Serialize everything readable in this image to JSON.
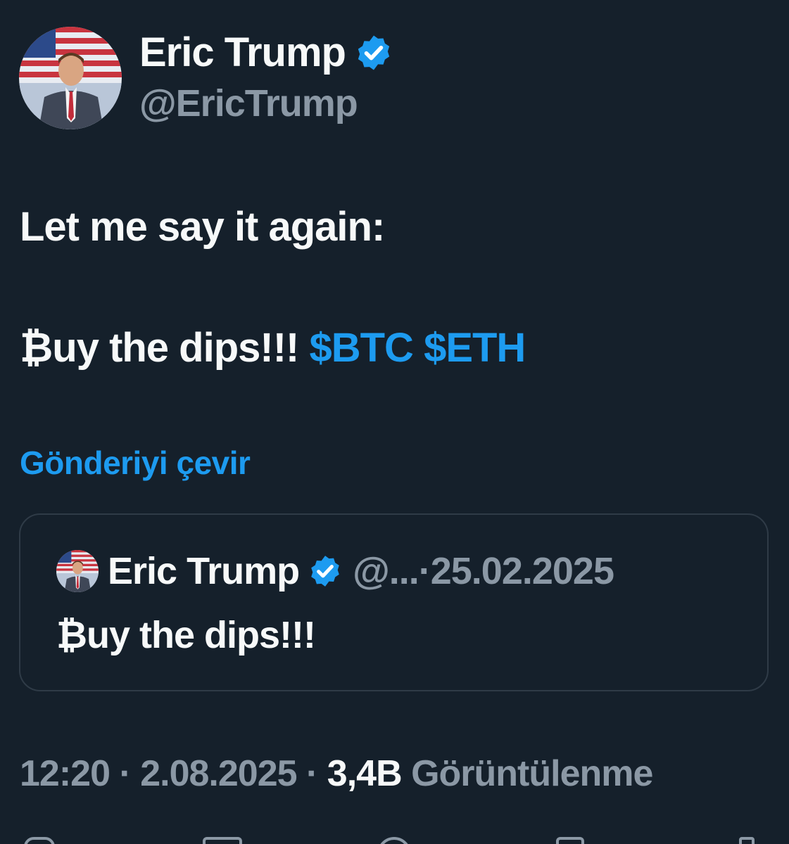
{
  "author": {
    "name": "Eric Trump",
    "handle": "@EricTrump",
    "avatar_icon": "profile-photo",
    "verified_icon": "verified-badge-icon"
  },
  "tweet": {
    "line1": "Let me say it again:",
    "line2_text": "₿uy the dips!!! ",
    "cashtag1": "$BTC",
    "cashtag2": "$ETH"
  },
  "translate_label": "Gönderiyi çevir",
  "quote": {
    "name": "Eric Trump",
    "handle": "@...",
    "separator": " · ",
    "date": "25.02.2025",
    "text": "₿uy the dips!!!"
  },
  "meta": {
    "time": "12:20",
    "sep1": " · ",
    "date": "2.08.2025",
    "sep2": " · ",
    "views_count": "3,4B",
    "views_label": " Görüntülenme"
  },
  "actions": [
    "reply-icon",
    "retweet-icon",
    "like-icon",
    "bookmark-icon",
    "share-icon"
  ],
  "colors": {
    "background": "#15202b",
    "text": "#f7f9f9",
    "muted": "#8b98a5",
    "accent": "#1d9bf0",
    "border": "#2f3b47"
  }
}
